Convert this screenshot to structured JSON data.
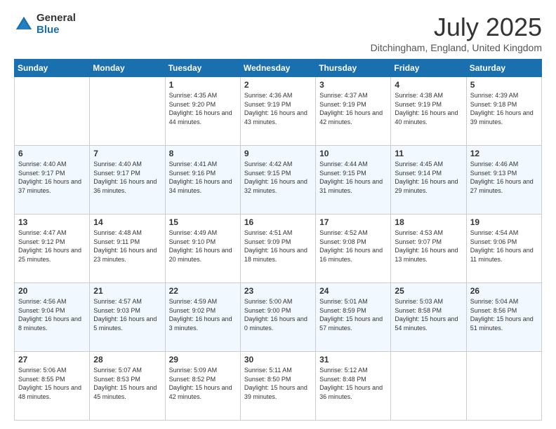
{
  "header": {
    "logo_general": "General",
    "logo_blue": "Blue",
    "month_title": "July 2025",
    "location": "Ditchingham, England, United Kingdom"
  },
  "weekdays": [
    "Sunday",
    "Monday",
    "Tuesday",
    "Wednesday",
    "Thursday",
    "Friday",
    "Saturday"
  ],
  "weeks": [
    [
      {
        "day": "",
        "info": ""
      },
      {
        "day": "",
        "info": ""
      },
      {
        "day": "1",
        "info": "Sunrise: 4:35 AM\nSunset: 9:20 PM\nDaylight: 16 hours\nand 44 minutes."
      },
      {
        "day": "2",
        "info": "Sunrise: 4:36 AM\nSunset: 9:19 PM\nDaylight: 16 hours\nand 43 minutes."
      },
      {
        "day": "3",
        "info": "Sunrise: 4:37 AM\nSunset: 9:19 PM\nDaylight: 16 hours\nand 42 minutes."
      },
      {
        "day": "4",
        "info": "Sunrise: 4:38 AM\nSunset: 9:19 PM\nDaylight: 16 hours\nand 40 minutes."
      },
      {
        "day": "5",
        "info": "Sunrise: 4:39 AM\nSunset: 9:18 PM\nDaylight: 16 hours\nand 39 minutes."
      }
    ],
    [
      {
        "day": "6",
        "info": "Sunrise: 4:40 AM\nSunset: 9:17 PM\nDaylight: 16 hours\nand 37 minutes."
      },
      {
        "day": "7",
        "info": "Sunrise: 4:40 AM\nSunset: 9:17 PM\nDaylight: 16 hours\nand 36 minutes."
      },
      {
        "day": "8",
        "info": "Sunrise: 4:41 AM\nSunset: 9:16 PM\nDaylight: 16 hours\nand 34 minutes."
      },
      {
        "day": "9",
        "info": "Sunrise: 4:42 AM\nSunset: 9:15 PM\nDaylight: 16 hours\nand 32 minutes."
      },
      {
        "day": "10",
        "info": "Sunrise: 4:44 AM\nSunset: 9:15 PM\nDaylight: 16 hours\nand 31 minutes."
      },
      {
        "day": "11",
        "info": "Sunrise: 4:45 AM\nSunset: 9:14 PM\nDaylight: 16 hours\nand 29 minutes."
      },
      {
        "day": "12",
        "info": "Sunrise: 4:46 AM\nSunset: 9:13 PM\nDaylight: 16 hours\nand 27 minutes."
      }
    ],
    [
      {
        "day": "13",
        "info": "Sunrise: 4:47 AM\nSunset: 9:12 PM\nDaylight: 16 hours\nand 25 minutes."
      },
      {
        "day": "14",
        "info": "Sunrise: 4:48 AM\nSunset: 9:11 PM\nDaylight: 16 hours\nand 23 minutes."
      },
      {
        "day": "15",
        "info": "Sunrise: 4:49 AM\nSunset: 9:10 PM\nDaylight: 16 hours\nand 20 minutes."
      },
      {
        "day": "16",
        "info": "Sunrise: 4:51 AM\nSunset: 9:09 PM\nDaylight: 16 hours\nand 18 minutes."
      },
      {
        "day": "17",
        "info": "Sunrise: 4:52 AM\nSunset: 9:08 PM\nDaylight: 16 hours\nand 16 minutes."
      },
      {
        "day": "18",
        "info": "Sunrise: 4:53 AM\nSunset: 9:07 PM\nDaylight: 16 hours\nand 13 minutes."
      },
      {
        "day": "19",
        "info": "Sunrise: 4:54 AM\nSunset: 9:06 PM\nDaylight: 16 hours\nand 11 minutes."
      }
    ],
    [
      {
        "day": "20",
        "info": "Sunrise: 4:56 AM\nSunset: 9:04 PM\nDaylight: 16 hours\nand 8 minutes."
      },
      {
        "day": "21",
        "info": "Sunrise: 4:57 AM\nSunset: 9:03 PM\nDaylight: 16 hours\nand 5 minutes."
      },
      {
        "day": "22",
        "info": "Sunrise: 4:59 AM\nSunset: 9:02 PM\nDaylight: 16 hours\nand 3 minutes."
      },
      {
        "day": "23",
        "info": "Sunrise: 5:00 AM\nSunset: 9:00 PM\nDaylight: 16 hours\nand 0 minutes."
      },
      {
        "day": "24",
        "info": "Sunrise: 5:01 AM\nSunset: 8:59 PM\nDaylight: 15 hours\nand 57 minutes."
      },
      {
        "day": "25",
        "info": "Sunrise: 5:03 AM\nSunset: 8:58 PM\nDaylight: 15 hours\nand 54 minutes."
      },
      {
        "day": "26",
        "info": "Sunrise: 5:04 AM\nSunset: 8:56 PM\nDaylight: 15 hours\nand 51 minutes."
      }
    ],
    [
      {
        "day": "27",
        "info": "Sunrise: 5:06 AM\nSunset: 8:55 PM\nDaylight: 15 hours\nand 48 minutes."
      },
      {
        "day": "28",
        "info": "Sunrise: 5:07 AM\nSunset: 8:53 PM\nDaylight: 15 hours\nand 45 minutes."
      },
      {
        "day": "29",
        "info": "Sunrise: 5:09 AM\nSunset: 8:52 PM\nDaylight: 15 hours\nand 42 minutes."
      },
      {
        "day": "30",
        "info": "Sunrise: 5:11 AM\nSunset: 8:50 PM\nDaylight: 15 hours\nand 39 minutes."
      },
      {
        "day": "31",
        "info": "Sunrise: 5:12 AM\nSunset: 8:48 PM\nDaylight: 15 hours\nand 36 minutes."
      },
      {
        "day": "",
        "info": ""
      },
      {
        "day": "",
        "info": ""
      }
    ]
  ]
}
